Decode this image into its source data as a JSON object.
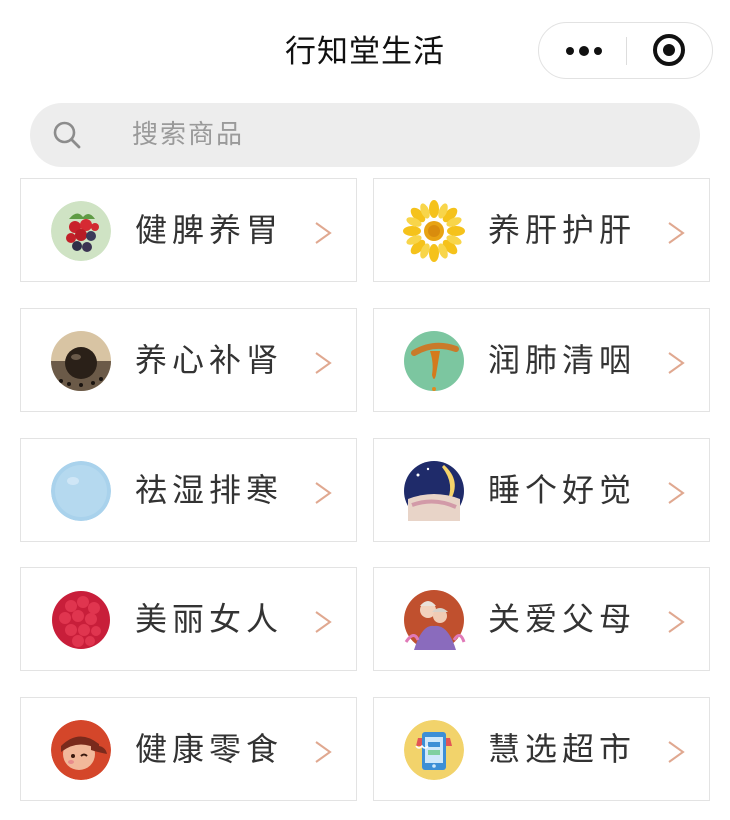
{
  "nav": {
    "title": "行知堂生活",
    "more_icon": "more-dots-icon",
    "close_icon": "close-target-icon"
  },
  "search": {
    "placeholder": "搜索商品",
    "icon": "search-icon"
  },
  "categories": [
    {
      "label": "健脾养胃",
      "icon": "berries-icon"
    },
    {
      "label": "养肝护肝",
      "icon": "sunflower-icon"
    },
    {
      "label": "养心补肾",
      "icon": "black-bead-icon"
    },
    {
      "label": "润肺清咽",
      "icon": "honey-spoon-icon"
    },
    {
      "label": "祛湿排寒",
      "icon": "blue-balloon-icon"
    },
    {
      "label": "睡个好觉",
      "icon": "moon-night-icon"
    },
    {
      "label": "美丽女人",
      "icon": "raspberry-icon"
    },
    {
      "label": "关爱父母",
      "icon": "elderly-couple-icon"
    },
    {
      "label": "健康零食",
      "icon": "cartoon-face-icon"
    },
    {
      "label": "慧选超市",
      "icon": "store-phone-icon"
    }
  ],
  "colors": {
    "arrow": "#e0a890",
    "border": "#e3e3e3",
    "search_bg": "#ededed"
  }
}
